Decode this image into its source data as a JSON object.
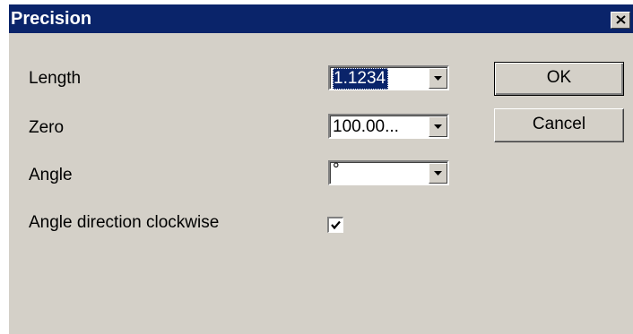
{
  "dialog": {
    "title": "Precision",
    "close_icon": "close-x-icon"
  },
  "fields": {
    "length": {
      "label": "Length",
      "value": "1.1234"
    },
    "zero": {
      "label": "Zero",
      "value": "100.00..."
    },
    "angle": {
      "label": "Angle",
      "value": "°"
    },
    "angle_direction": {
      "label": "Angle direction clockwise",
      "checked": true
    }
  },
  "buttons": {
    "ok": "OK",
    "cancel": "Cancel"
  },
  "colors": {
    "title_bar": "#0a246a",
    "face": "#d4d0c8",
    "selection": "#0a246a"
  }
}
